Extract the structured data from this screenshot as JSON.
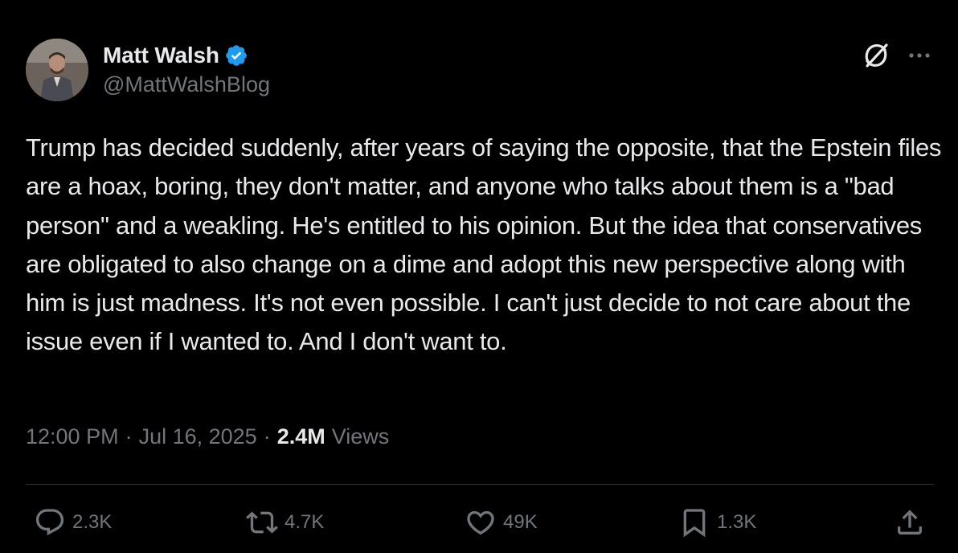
{
  "author": {
    "display_name": "Matt Walsh",
    "handle": "@MattWalshBlog",
    "verified": true
  },
  "tweet": {
    "text": "Trump has decided suddenly, after years of saying the opposite, that the Epstein files are a hoax, boring, they don't matter, and anyone who talks about them is a \"bad person\" and a weakling. He's entitled to his opinion. But the idea that conservatives are obligated to also change on a dime and adopt this new perspective along with him is just madness. It's not even possible. I can't just decide to not care about the issue even if I wanted to. And I don't want to.",
    "time": "12:00 PM",
    "date": "Jul 16, 2025",
    "separator": "·",
    "views_count": "2.4M",
    "views_label": "Views"
  },
  "actions": {
    "reply_count": "2.3K",
    "repost_count": "4.7K",
    "like_count": "49K",
    "bookmark_count": "1.3K"
  },
  "icons": {
    "verified": "verified-badge-icon",
    "grok": "grok-icon",
    "more": "more-icon",
    "reply": "reply-icon",
    "repost": "repost-icon",
    "like": "heart-icon",
    "bookmark": "bookmark-icon",
    "share": "share-icon"
  },
  "colors": {
    "background": "#000000",
    "primary_text": "#e7e9ea",
    "secondary_text": "#71767b",
    "verified_blue": "#1d9bf0",
    "divider": "#2f3336"
  }
}
